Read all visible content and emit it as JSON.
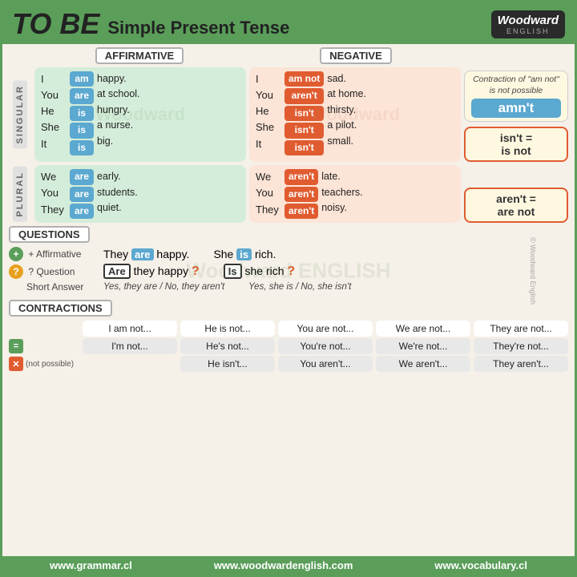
{
  "header": {
    "title_tobe": "TO BE",
    "title_sub": "Simple Present Tense",
    "logo_text": "Woodward",
    "logo_sub": "ENGLISH"
  },
  "sections": {
    "affirmative_label": "AFFIRMATIVE",
    "negative_label": "NEGATIVE",
    "questions_label": "QUESTIONS",
    "contractions_label": "CONTRACTIONS",
    "singular_label": "SINGULAR",
    "plural_label": "PLURAL"
  },
  "singular": {
    "affirmative": {
      "pronouns": [
        "I",
        "You",
        "He",
        "She",
        "It"
      ],
      "verbs": [
        "am",
        "are",
        "is",
        "is",
        "is"
      ],
      "adjectives": [
        "happy.",
        "at school.",
        "hungry.",
        "a nurse.",
        "big."
      ]
    },
    "negative": {
      "pronouns": [
        "I",
        "You",
        "He",
        "She",
        "It"
      ],
      "verbs": [
        "am not",
        "aren't",
        "isn't",
        "isn't",
        "isn't"
      ],
      "adjectives": [
        "sad.",
        "at home.",
        "thirsty.",
        "a pilot.",
        "small."
      ]
    }
  },
  "plural": {
    "affirmative": {
      "pronouns": [
        "We",
        "You",
        "They"
      ],
      "verbs": [
        "are",
        "are",
        "are"
      ],
      "adjectives": [
        "early.",
        "students.",
        "quiet."
      ]
    },
    "negative": {
      "pronouns": [
        "We",
        "You",
        "They"
      ],
      "verbs": [
        "aren't",
        "aren't",
        "aren't"
      ],
      "adjectives": [
        "late.",
        "teachers.",
        "noisy."
      ]
    }
  },
  "callouts": {
    "contraction_note": "Contraction of \"am not\" is not possible",
    "amnt_label": "amn't",
    "isnt_line1": "isn't =",
    "isnt_line2": "is not",
    "arent_line1": "aren't =",
    "arent_line2": "are not"
  },
  "questions": {
    "affirmative_label": "+ Affirmative",
    "question_label": "? Question",
    "short_answer_label": "Short Answer",
    "examples": [
      {
        "affirmative": "They are happy.",
        "affirmative_verb": "are",
        "question": "Are they happy ?",
        "question_verb": "Are",
        "short_answer": "Yes, they are / No, they aren't"
      },
      {
        "affirmative": "She is rich.",
        "affirmative_verb": "is",
        "question": "Is she rich ?",
        "question_verb": "Is",
        "short_answer": "Yes, she is / No, she isn't"
      }
    ]
  },
  "contractions": {
    "rows": [
      {
        "type": "original",
        "cells": [
          "I am not...",
          "He is not...",
          "You are not...",
          "We are not...",
          "They are not..."
        ]
      },
      {
        "type": "contraction",
        "cells": [
          "I'm not...",
          "He's not...",
          "You're not...",
          "We're not...",
          "They're not..."
        ]
      },
      {
        "type": "not_possible",
        "label": "✕ (not possible)",
        "cells": [
          "He isn't...",
          "You aren't...",
          "We aren't...",
          "They aren't..."
        ]
      }
    ]
  },
  "footer": {
    "links": [
      "www.grammar.cl",
      "www.woodwardenglish.com",
      "www.vocabulary.cl"
    ]
  },
  "watermark": "Woodward ENGLISH"
}
